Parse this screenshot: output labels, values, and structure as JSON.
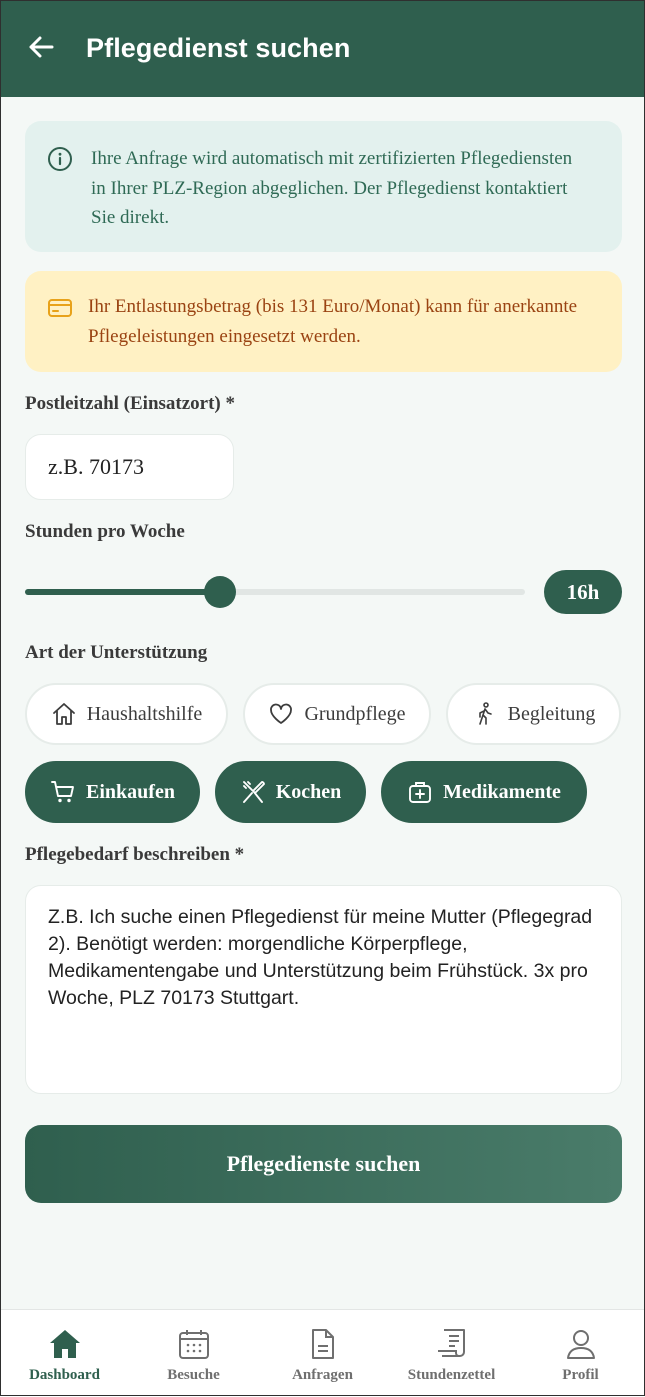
{
  "header": {
    "title": "Pflegedienst suchen"
  },
  "info_box": {
    "text": "Ihre Anfrage wird automatisch mit zertifizierten Pflegediensten in Ihrer PLZ-Region abgeglichen. Der Pflegedienst kontaktiert Sie direkt."
  },
  "budget_box": {
    "text": "Ihr Entlastungsbetrag (bis 131 Euro/Monat) kann für anerkannte Pflegeleistungen eingesetzt werden."
  },
  "postcode": {
    "label": "Postleitzahl (Einsatzort) *",
    "placeholder": "z.B. 70173",
    "value": ""
  },
  "hours": {
    "label": "Stunden pro Woche",
    "value_label": "16h",
    "fraction": 0.39
  },
  "support": {
    "label": "Art der Unterstützung",
    "chips": [
      {
        "label": "Haushaltshilfe",
        "icon": "home-icon",
        "selected": false
      },
      {
        "label": "Grundpflege",
        "icon": "heart-icon",
        "selected": false
      },
      {
        "label": "Begleitung",
        "icon": "walking-icon",
        "selected": false
      },
      {
        "label": "Einkaufen",
        "icon": "cart-icon",
        "selected": true
      },
      {
        "label": "Kochen",
        "icon": "utensils-icon",
        "selected": true
      },
      {
        "label": "Medikamente",
        "icon": "medical-kit-icon",
        "selected": true
      }
    ]
  },
  "description": {
    "label": "Pflegebedarf beschreiben *",
    "placeholder": "Z.B. Ich suche einen Pflegedienst für meine Mutter (Pflegegrad 2). Benötigt werden: morgendliche Körperpflege, Medikamentengabe und Unterstützung beim Frühstück. 3x pro Woche, PLZ 70173 Stuttgart."
  },
  "submit": {
    "label": "Pflegedienste suchen"
  },
  "bottom_nav": [
    {
      "label": "Dashboard",
      "icon": "home-icon",
      "active": true
    },
    {
      "label": "Besuche",
      "icon": "calendar-icon",
      "active": false
    },
    {
      "label": "Anfragen",
      "icon": "document-icon",
      "active": false
    },
    {
      "label": "Stundenzettel",
      "icon": "receipt-icon",
      "active": false
    },
    {
      "label": "Profil",
      "icon": "user-icon",
      "active": false
    }
  ],
  "colors": {
    "primary": "#2f5f4e",
    "info_bg": "#e3f1ee",
    "info_text": "#2f6a55",
    "warn_bg": "#fff1c4",
    "warn_text": "#9a4312",
    "warn_icon": "#e8a21a"
  }
}
